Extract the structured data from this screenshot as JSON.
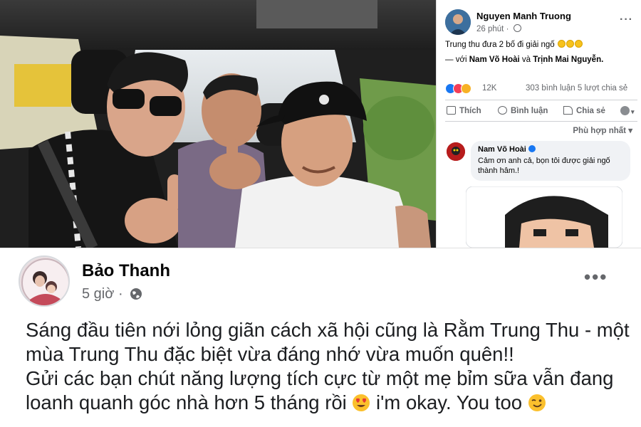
{
  "fb_panel": {
    "author": "Nguyen Manh Truong",
    "time": "26 phút",
    "post_text": "Trung thu đưa 2 bố đi giải ngố",
    "tag_prefix": "— với",
    "tag_person1": "Nam Võ Hoài",
    "tag_joiner": "và",
    "tag_person2": "Trịnh Mai Nguyễn.",
    "reactions_count": "12K",
    "comments_shares": "303 bình luận  5 lượt chia sẻ",
    "actions": {
      "like": "Thích",
      "comment": "Bình luận",
      "share": "Chia sẻ"
    },
    "sort_label": "Phù hợp nhất",
    "comment": {
      "author": "Nam Võ Hoài",
      "text": "Cảm ơn anh cả, bọn tôi được giải ngố thành hâm.!"
    }
  },
  "post": {
    "author": "Bảo Thanh",
    "time": "5 giờ",
    "separator": "·",
    "lines": [
      "Sáng đầu tiên nới lỏng giãn cách xã hội cũng là Rằm Trung Thu - một",
      "mùa Trung Thu đặc biệt vừa đáng nhớ vừa muốn quên!!",
      "Gửi các bạn chút năng lượng tích cực từ một mẹ bỉm sữa vẫn đang",
      "loanh quanh góc nhà hơn 5 tháng rồi",
      "i'm okay. You too"
    ]
  },
  "icons": {
    "photo": "selfie-photo",
    "globe": "globe-icon",
    "more": "more-options-icon",
    "heart_eyes": "heart-eyes-emoji",
    "wink": "wink-emoji"
  },
  "colors": {
    "text_primary": "#050505",
    "text_secondary": "#65676b",
    "like_blue": "#1877f2",
    "love_red": "#f33e58"
  }
}
